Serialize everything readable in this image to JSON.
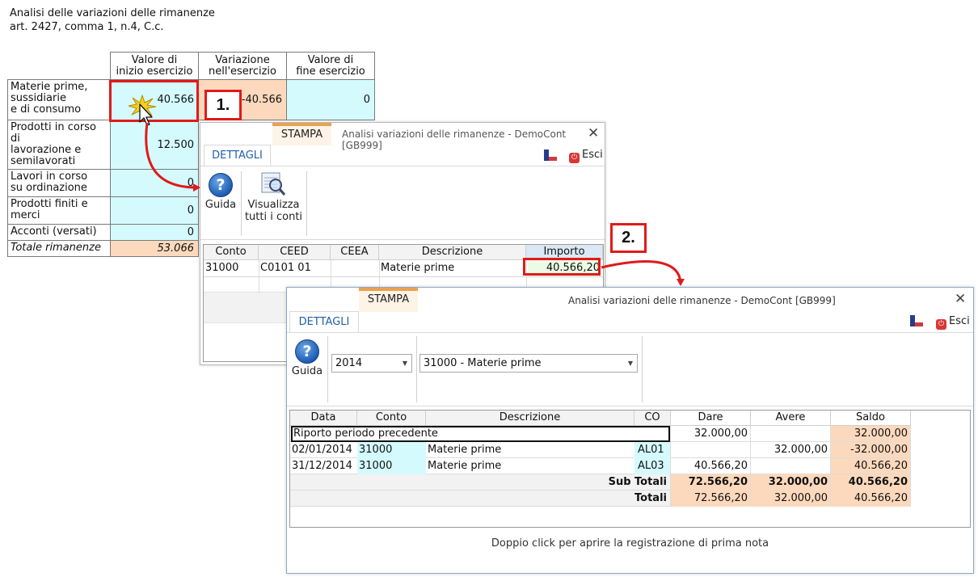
{
  "report": {
    "title_line1": "Analisi delle variazioni delle rimanenze",
    "title_line2": "art. 2427, comma 1, n.4, C.c."
  },
  "summary_table": {
    "headers": [
      "Valore di\ninizio esercizio",
      "Variazione\nnell'esercizio",
      "Valore di\nfine esercizio"
    ],
    "rows": [
      {
        "label": "Materie prime,\nsussidiarie\ne di consumo",
        "start": "40.566",
        "variation": "-40.566",
        "end": "0"
      },
      {
        "label": "Prodotti in corso di\nlavorazione e\nsemilavorati",
        "start": "12.500"
      },
      {
        "label": "Lavori in corso\nsu ordinazione",
        "start": "0"
      },
      {
        "label": "Prodotti finiti e\nmerci",
        "start": "0"
      },
      {
        "label": "Acconti (versati)",
        "start": "0"
      }
    ],
    "total": {
      "label": "Totale rimanenze",
      "start": "53.066"
    }
  },
  "annotations": {
    "step1": "1.",
    "step2": "2."
  },
  "window1": {
    "title": "Analisi variazioni delle rimanenze - DemoCont [GB999]",
    "tabs": [
      "DETTAGLI",
      "STAMPA"
    ],
    "exit_label": "Esci",
    "buttons": {
      "help": "Guida",
      "view_all": "Visualizza\ntutti i conti"
    },
    "grid": {
      "columns": [
        "Conto",
        "CEED",
        "CEEA",
        "Descrizione",
        "Importo"
      ],
      "rows": [
        {
          "conto": "31000",
          "ceed": "C0101 01",
          "ceea": "",
          "descrizione": "Materie prime",
          "importo": "40.566,20"
        }
      ]
    }
  },
  "window2": {
    "title": "Analisi variazioni delle rimanenze - DemoCont [GB999]",
    "tabs": [
      "DETTAGLI",
      "STAMPA"
    ],
    "exit_label": "Esci",
    "help_label": "Guida",
    "year_select": "2014",
    "account_select": "31000 - Materie prime",
    "grid": {
      "columns": [
        "Data",
        "Conto",
        "Descrizione",
        "CO",
        "Dare",
        "Avere",
        "Saldo"
      ],
      "opening_row": {
        "label": "Riporto periodo precedente",
        "dare": "32.000,00",
        "avere": "",
        "saldo": "32.000,00"
      },
      "rows": [
        {
          "data": "02/01/2014",
          "conto": "31000",
          "descrizione": "Materie prime",
          "co": "AL01",
          "dare": "",
          "avere": "32.000,00",
          "saldo": "-32.000,00"
        },
        {
          "data": "31/12/2014",
          "conto": "31000",
          "descrizione": "Materie prime",
          "co": "AL03",
          "dare": "40.566,20",
          "avere": "",
          "saldo": "40.566,20"
        }
      ],
      "subtotal": {
        "label": "Sub Totali",
        "dare": "72.566,20",
        "avere": "32.000,00",
        "saldo": "40.566,20"
      },
      "total": {
        "label": "Totali",
        "dare": "72.566,20",
        "avere": "32.000,00",
        "saldo": "40.566,20"
      }
    },
    "footer_note": "Doppio click per aprire la registrazione di prima nota"
  },
  "colors": {
    "accent_red": "#e01a1a",
    "cyan_cell": "#d4fafd",
    "peach_cell": "#fcd9bd",
    "tab_blue": "#1f5fa8"
  }
}
